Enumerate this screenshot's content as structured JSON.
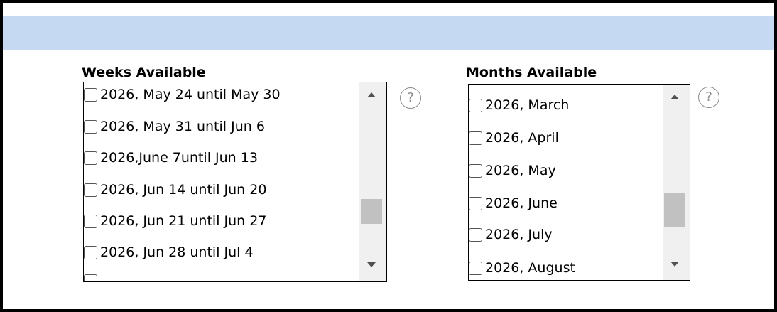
{
  "weeks": {
    "label": "Weeks Available",
    "help_icon": "?",
    "items": [
      {
        "label": "2026, May 24 until May 30",
        "checked": false
      },
      {
        "label": "2026, May 31 until Jun 6",
        "checked": false
      },
      {
        "label": "2026,June 7until Jun 13",
        "checked": false
      },
      {
        "label": "2026, Jun 14 until Jun 20",
        "checked": false
      },
      {
        "label": "2026, Jun 21 until Jun 27",
        "checked": false
      },
      {
        "label": "2026, Jun 28 until Jul 4",
        "checked": false
      }
    ]
  },
  "months": {
    "label": "Months Available",
    "help_icon": "?",
    "items": [
      {
        "label": "2026, March",
        "checked": false
      },
      {
        "label": "2026, April",
        "checked": false
      },
      {
        "label": "2026, May",
        "checked": false
      },
      {
        "label": "2026, June",
        "checked": false
      },
      {
        "label": "2026, July",
        "checked": false
      },
      {
        "label": "2026, August",
        "checked": false
      }
    ]
  },
  "colors": {
    "banner": "#c5d9f3",
    "frame_border": "#000000",
    "scrollbar_track": "#f0f0f0",
    "scrollbar_thumb": "#c1c1c1"
  }
}
